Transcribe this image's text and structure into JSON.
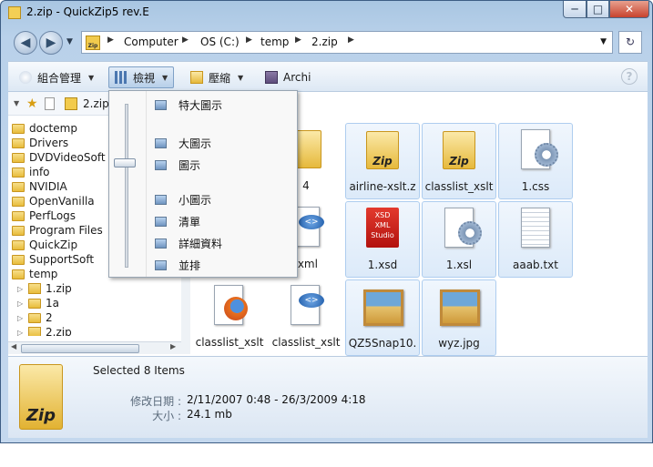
{
  "window": {
    "title": "2.zip - QuickZip5 rev.E",
    "min": "─",
    "max": "□",
    "close": "✕"
  },
  "nav": {
    "back": "◀",
    "forward": "▶",
    "zip_badge": "Zip",
    "breadcrumb": [
      "Computer",
      "OS (C:)",
      "temp",
      "2.zip"
    ],
    "sep": "▶",
    "dropdown": "▼",
    "refresh": "↻"
  },
  "toolbar": {
    "organize": "組合管理",
    "view": "檢視",
    "compress": "壓縮",
    "archi": "Archi",
    "caret": "▼",
    "help": "?"
  },
  "tree_header": {
    "label": "2.zip",
    "star": "★"
  },
  "tree": [
    {
      "label": "doctemp",
      "type": "folder"
    },
    {
      "label": "Drivers",
      "type": "folder"
    },
    {
      "label": "DVDVideoSoft",
      "type": "folder"
    },
    {
      "label": "info",
      "type": "folder"
    },
    {
      "label": "NVIDIA",
      "type": "folder"
    },
    {
      "label": "OpenVanilla",
      "type": "folder"
    },
    {
      "label": "PerfLogs",
      "type": "folder"
    },
    {
      "label": "Program Files",
      "type": "folder"
    },
    {
      "label": "QuickZip",
      "type": "folder"
    },
    {
      "label": "SupportSoft",
      "type": "folder"
    },
    {
      "label": "temp",
      "type": "folder"
    },
    {
      "label": "1.zip",
      "type": "zip"
    },
    {
      "label": "1a",
      "type": "subfolder"
    },
    {
      "label": "2",
      "type": "subfolder"
    },
    {
      "label": "2.zip",
      "type": "zip"
    }
  ],
  "view_menu": {
    "items": [
      "特大圖示",
      "大圖示",
      "圖示",
      "小圖示",
      "清單",
      "詳細資料",
      "並排"
    ]
  },
  "files": [
    {
      "label": "4",
      "icon": "folder-icon"
    },
    {
      "label": "airline-xslt.z",
      "icon": "zip-folder-icon",
      "badge": "Zip"
    },
    {
      "label": "classlist_xslt",
      "icon": "zip-folder-icon",
      "badge": "Zip"
    },
    {
      "label": "1.css",
      "icon": "css-file-icon"
    },
    {
      "label": ".xml",
      "icon": "xml-file-icon"
    },
    {
      "label": "1.xsd",
      "icon": "xsd-file-icon",
      "badge": "XSD XML Studio"
    },
    {
      "label": "1.xsl",
      "icon": "xsl-file-icon"
    },
    {
      "label": "aaab.txt",
      "icon": "text-file-icon"
    },
    {
      "label": "classlist_xslt",
      "icon": "firefox-icon"
    },
    {
      "label": "classlist_xslt",
      "icon": "xml-file-icon"
    },
    {
      "label": "QZ5Snap10.",
      "icon": "image-file-icon"
    },
    {
      "label": "wyz.jpg",
      "icon": "image-file-icon"
    }
  ],
  "details": {
    "selected": "Selected 8 Items",
    "modified_key": "修改日期 :",
    "modified_val": "2/11/2007 0:48 - 26/3/2009 4:18",
    "size_key": "大小 :",
    "size_val": "24.1 mb",
    "zip_badge": "Zip"
  }
}
